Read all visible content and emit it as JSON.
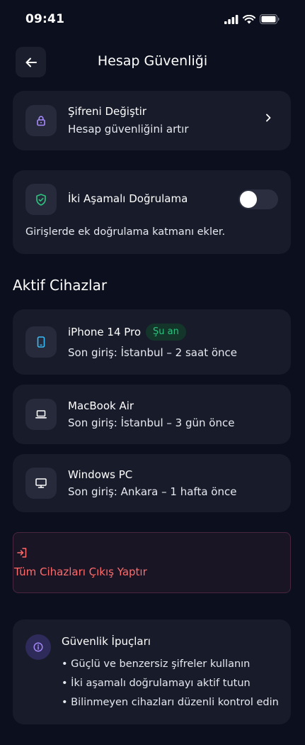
{
  "status": {
    "time": "09:41"
  },
  "header": {
    "title": "Hesap Güvenliği"
  },
  "password": {
    "title": "Şifreni Değiştir",
    "subtitle": "Hesap güvenliğini artır"
  },
  "two_factor": {
    "title": "İki Aşamalı Doğrulama",
    "description": "Girişlerde ek doğrulama katmanı ekler.",
    "enabled": false
  },
  "devices": {
    "title": "Aktif Cihazlar",
    "items": [
      {
        "name": "iPhone 14 Pro",
        "last_login": "Son giriş: İstanbul – 2 saat önce",
        "badge": "Şu an",
        "icon": "phone-icon"
      },
      {
        "name": "MacBook Air",
        "last_login": "Son giriş: İstanbul – 3 gün önce",
        "icon": "laptop-icon"
      },
      {
        "name": "Windows PC",
        "last_login": "Son giriş: Ankara – 1 hafta önce",
        "icon": "desktop-icon"
      }
    ]
  },
  "logout_all": {
    "label": "Tüm Cihazları Çıkış Yaptır"
  },
  "tips": {
    "title": "Güvenlik İpuçları",
    "items": [
      "• Güçlü ve benzersiz şifreler kullanın",
      "• İki aşamalı doğrulamayı aktif tutun",
      "• Bilinmeyen cihazları düzenli kontrol edin"
    ]
  },
  "colors": {
    "background": "#0c0f1e",
    "card": "#181b2a",
    "accent_purple": "#a78bfa",
    "accent_green": "#2ec27e",
    "accent_cyan": "#38bdf8",
    "danger": "#ff6b6b"
  }
}
